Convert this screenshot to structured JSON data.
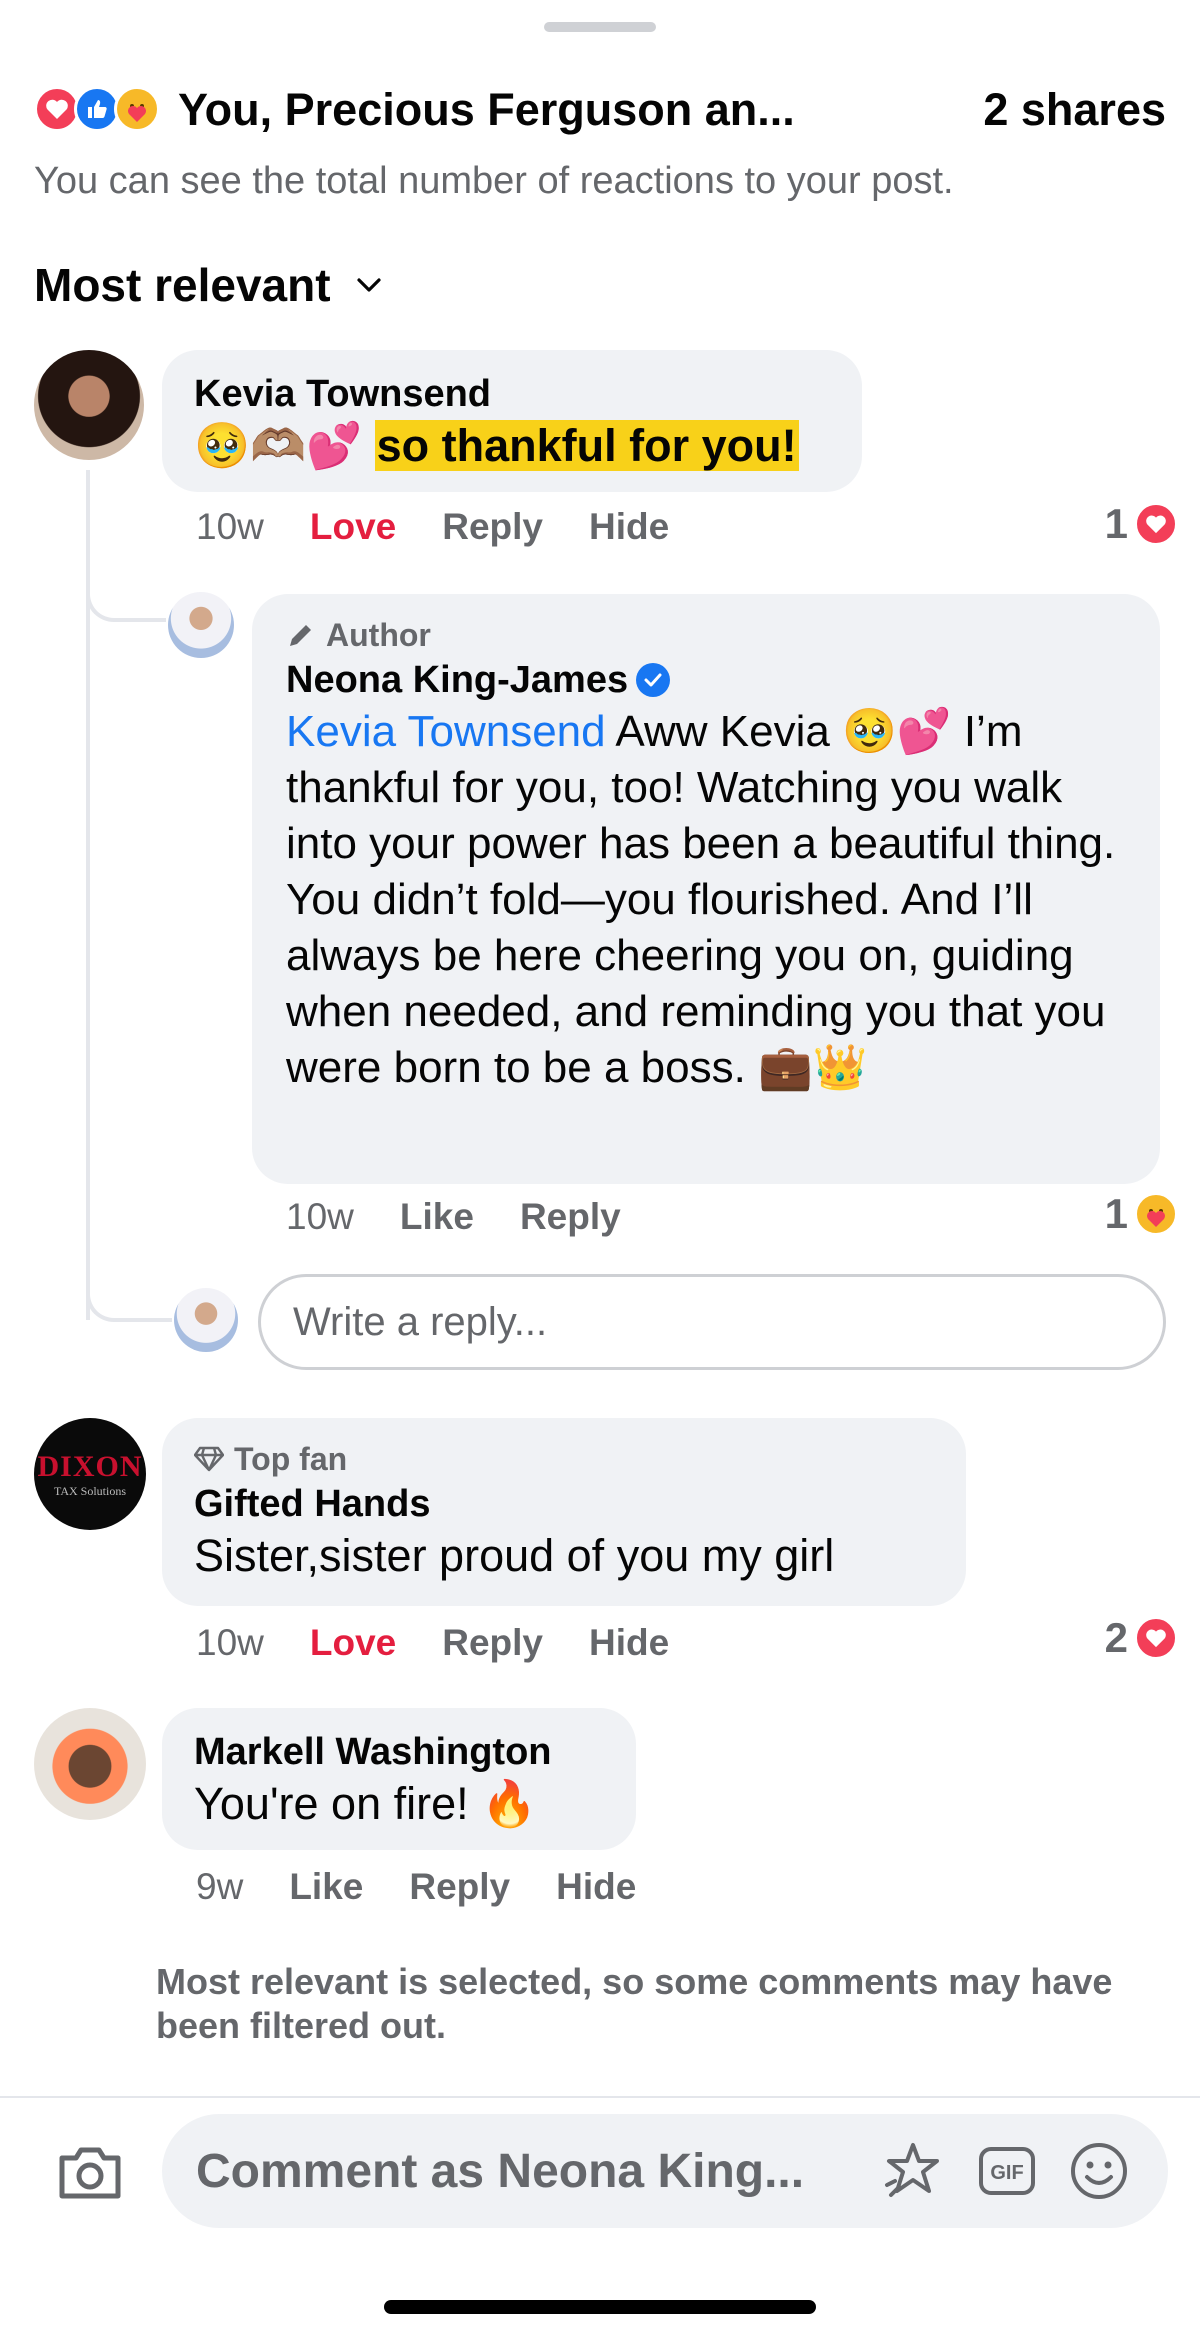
{
  "header": {
    "reaction_names": "You, Precious Ferguson an...",
    "shares": "2 shares",
    "info": "You can see the total number of reactions to your post.",
    "sort_label": "Most relevant"
  },
  "comments": [
    {
      "author": "Kevia Townsend",
      "emoji": "🥹🫶🏽💕",
      "text": "so thankful for you!",
      "time": "10w",
      "reaction_action": "Love",
      "reply": "Reply",
      "hide": "Hide",
      "reaction_count": "1"
    },
    {
      "badge": "Author",
      "author": "Neona King-James",
      "mention": "Kevia Townsend",
      "text": " Aww Kevia 🥹💕 I’m thankful for you, too! Watching you walk into your power has been a beautiful thing. You didn’t fold—you flourished. And I’ll always be here cheering you on, guiding when needed, and reminding you that you were born to be a boss. 💼👑",
      "time": "10w",
      "like": "Like",
      "reply": "Reply",
      "reaction_count": "1"
    },
    {
      "badge": "Top fan",
      "author": "Gifted Hands",
      "text": "Sister,sister proud of you my girl",
      "time": "10w",
      "reaction_action": "Love",
      "reply": "Reply",
      "hide": "Hide",
      "reaction_count": "2",
      "avatar_text": "DIXON",
      "avatar_subtext": "TAX Solutions"
    },
    {
      "author": "Markell Washington",
      "text": "You're on fire! 🔥",
      "time": "9w",
      "like": "Like",
      "reply": "Reply",
      "hide": "Hide"
    }
  ],
  "reply_input": {
    "placeholder": "Write a reply..."
  },
  "filtered_note": "Most relevant is selected, so some comments may have been filtered out.",
  "composer": {
    "placeholder": "Comment as Neona King..."
  },
  "icons": [
    "love-reaction-icon",
    "like-reaction-icon",
    "care-reaction-icon",
    "chevron-down-icon",
    "pencil-icon",
    "verified-badge-icon",
    "diamond-icon",
    "camera-icon",
    "avatar-sticker-icon",
    "gif-icon",
    "emoji-icon"
  ],
  "colors": {
    "accent": "#1877f2",
    "love": "#e41e3f",
    "highlight": "#f8d119",
    "bubble": "#f0f2f5",
    "secondary_text": "#65676b"
  }
}
